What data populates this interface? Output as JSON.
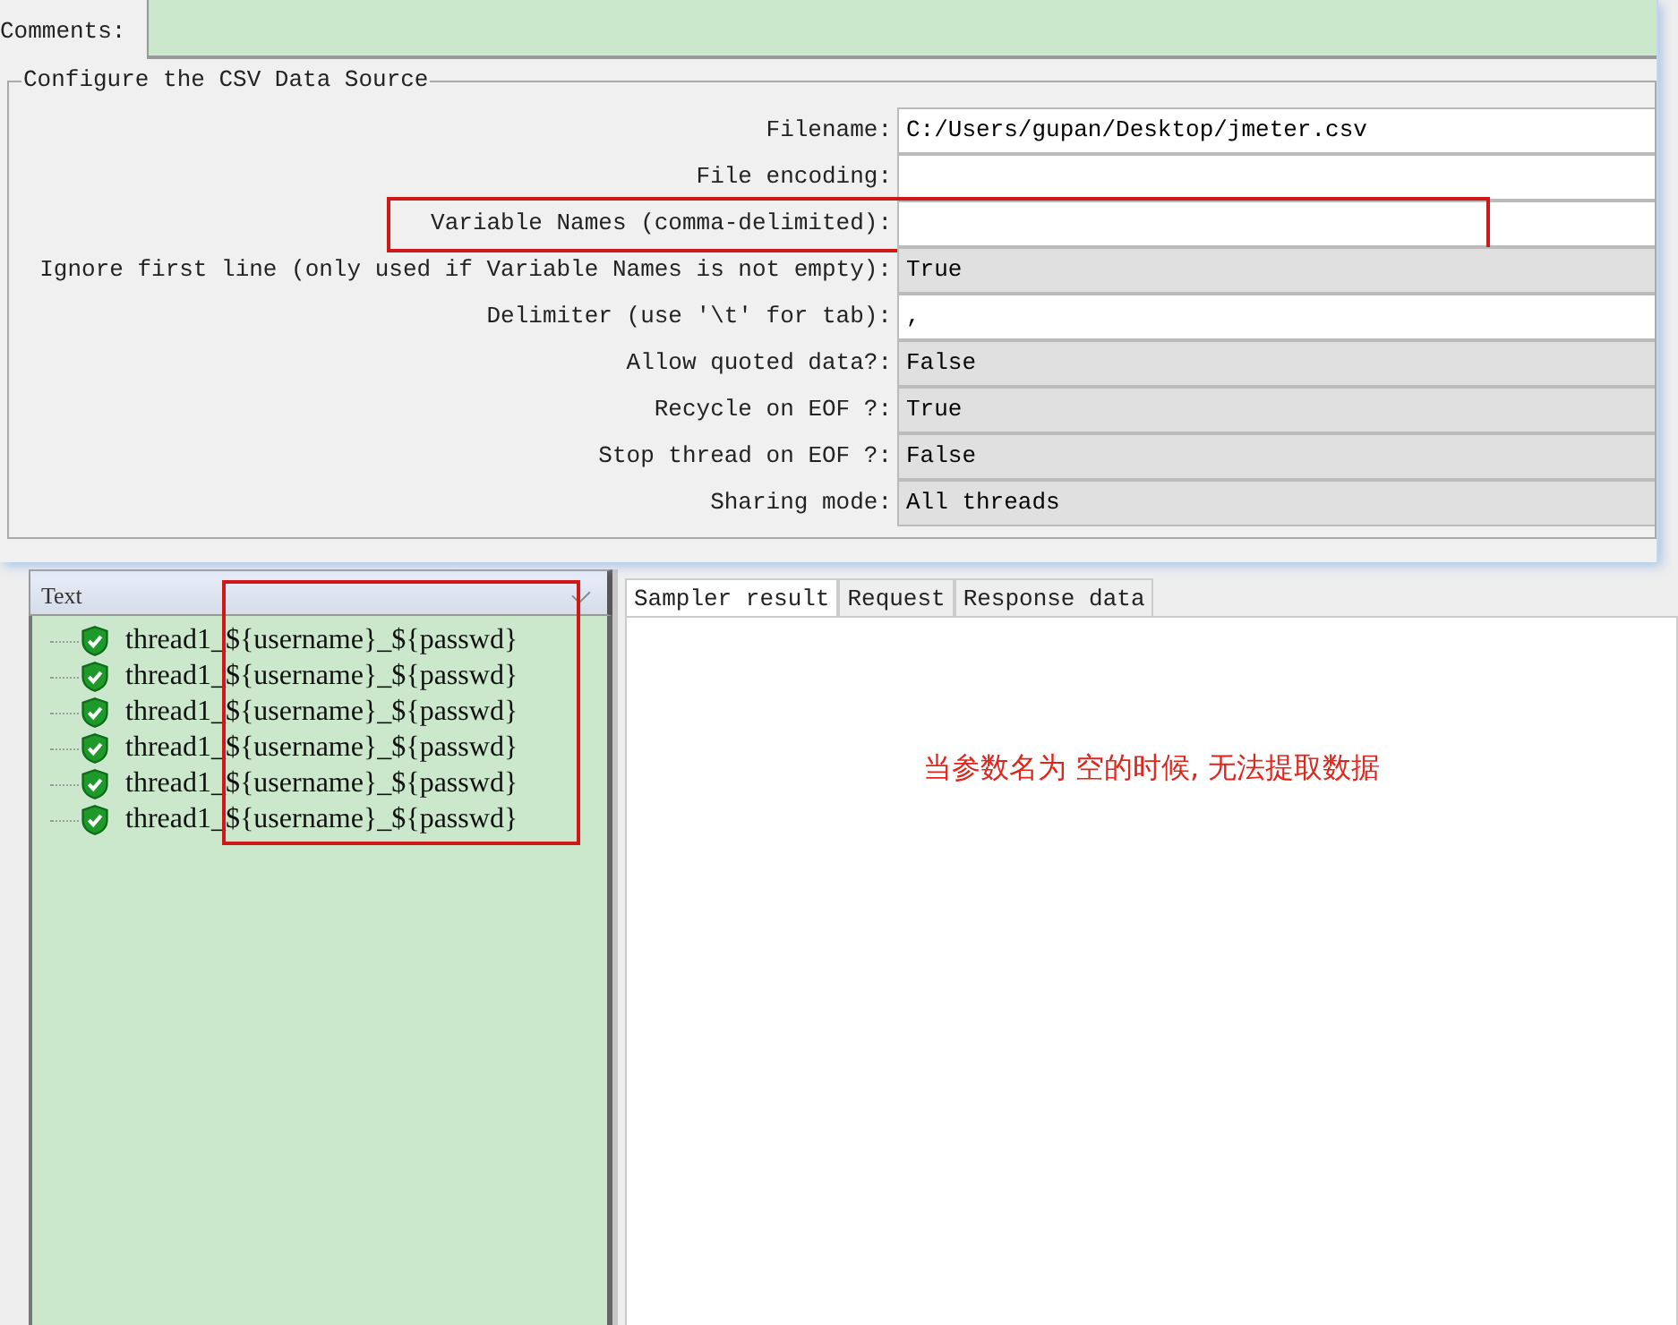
{
  "comments": {
    "label": "Comments:"
  },
  "csv_group": {
    "title": "Configure the CSV Data Source",
    "fields": [
      {
        "label": "Filename:",
        "kind": "text",
        "value": "C:/Users/gupan/Desktop/jmeter.csv",
        "highlighted": false
      },
      {
        "label": "File encoding:",
        "kind": "text",
        "highlighted": false
      },
      {
        "label": "Variable Names (comma-delimited):",
        "kind": "text",
        "highlighted": true
      },
      {
        "label": "Ignore first line (only used if Variable Names is not empty):",
        "kind": "choice",
        "value": "True",
        "highlighted": false
      },
      {
        "label": "Delimiter (use '\\t' for tab):",
        "kind": "text",
        "value": ",",
        "highlighted": false
      },
      {
        "label": "Allow quoted data?:",
        "kind": "choice",
        "value": "False",
        "highlighted": false
      },
      {
        "label": "Recycle on EOF ?:",
        "kind": "choice",
        "value": "True",
        "highlighted": false
      },
      {
        "label": "Stop thread on EOF ?:",
        "kind": "choice",
        "value": "False",
        "highlighted": false
      },
      {
        "label": "Sharing mode:",
        "kind": "choice",
        "value": "All threads",
        "highlighted": false
      }
    ]
  },
  "results_tree": {
    "header": "Text",
    "highlighted": true,
    "items": [
      {
        "prefix": "thread1_",
        "rest": "${username}_${passwd}"
      },
      {
        "prefix": "thread1_",
        "rest": "${username}_${passwd}"
      },
      {
        "prefix": "thread1_",
        "rest": "${username}_${passwd}"
      },
      {
        "prefix": "thread1_",
        "rest": "${username}_${passwd}"
      },
      {
        "prefix": "thread1_",
        "rest": "${username}_${passwd}"
      },
      {
        "prefix": "thread1_",
        "rest": "${username}_${passwd}"
      }
    ]
  },
  "tabs": [
    {
      "label": "Sampler result",
      "selected": true
    },
    {
      "label": "Request",
      "selected": false
    },
    {
      "label": "Response data",
      "selected": false
    }
  ],
  "note": "当参数名为 空的时候, 无法提取数据"
}
